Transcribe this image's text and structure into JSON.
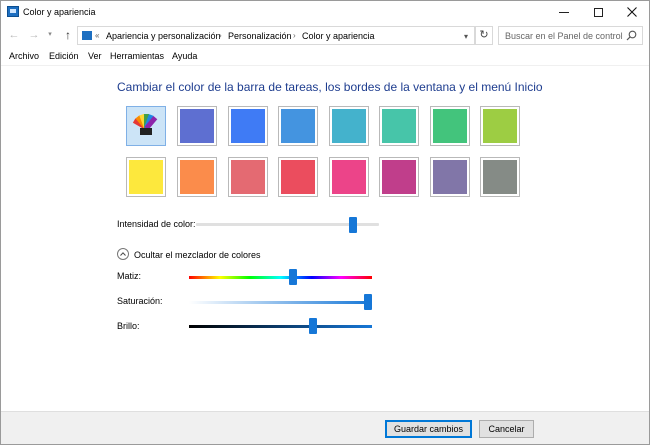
{
  "window": {
    "title": "Color y apariencia"
  },
  "address": {
    "overflow": "«",
    "crumbs": [
      "Apariencia y personalización",
      "Personalización",
      "Color y apariencia"
    ],
    "separator": "›"
  },
  "search": {
    "placeholder": "Buscar en el Panel de control"
  },
  "menu": [
    "Archivo",
    "Edición",
    "Ver",
    "Herramientas",
    "Ayuda"
  ],
  "content": {
    "heading": "Cambiar el color de la barra de tareas, los bordes de la ventana y el menú Inicio",
    "swatches_row1": [
      "automatic",
      "#5e6fd1",
      "#3f7bf5",
      "#4494e0",
      "#44b2cc",
      "#47c5a9",
      "#43c47c",
      "#9dcd43"
    ],
    "swatches_row2": [
      "#fde83d",
      "#fb8c4b",
      "#e46a72",
      "#eb4d5e",
      "#ec4489",
      "#c03e8b",
      "#8176a8",
      "#858b86"
    ],
    "intensity_label": "Intensidad de color:",
    "intensity_value": 0.86,
    "mixer_toggle_label": "Ocultar el mezclador de colores",
    "hue_label": "Matiz:",
    "hue_value": 0.57,
    "saturation_label": "Saturación:",
    "saturation_value": 0.98,
    "brightness_label": "Brillo:",
    "brightness_value": 0.68
  },
  "footer": {
    "save_label": "Guardar cambios",
    "cancel_label": "Cancelar"
  },
  "colors": {
    "accent": "#1677d7",
    "heading": "#1e3d8f"
  }
}
